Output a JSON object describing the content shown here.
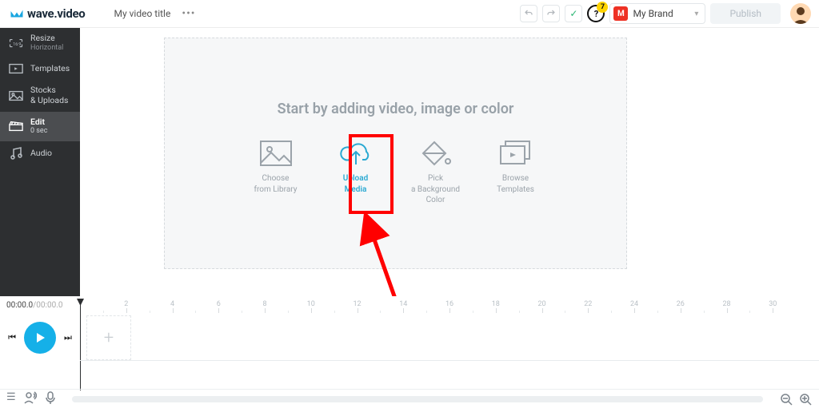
{
  "header": {
    "logo_text": "wave.video",
    "title": "My video title",
    "help_badge": "7",
    "brand_letter": "M",
    "brand_name": "My Brand",
    "publish": "Publish"
  },
  "sidebar": {
    "items": [
      {
        "label": "Resize",
        "sub": "Horizontal"
      },
      {
        "label": "Templates"
      },
      {
        "label": "Stocks\n& Uploads"
      },
      {
        "label": "Edit",
        "sub": "0 sec"
      },
      {
        "label": "Audio"
      }
    ]
  },
  "canvas": {
    "heading": "Start by adding video, image or color",
    "options": [
      {
        "line1": "Choose",
        "line2": "from Library"
      },
      {
        "line1": "Upload",
        "line2": "Media"
      },
      {
        "line1": "Pick",
        "line2": "a Background",
        "line3": "Color"
      },
      {
        "line1": "Browse",
        "line2": "Templates"
      }
    ]
  },
  "timeline": {
    "current": "00:00.0",
    "total": "/00:00.0",
    "marks": [
      "2",
      "4",
      "6",
      "8",
      "10",
      "12",
      "14",
      "16",
      "18",
      "20",
      "22",
      "24",
      "26",
      "28",
      "30"
    ]
  }
}
